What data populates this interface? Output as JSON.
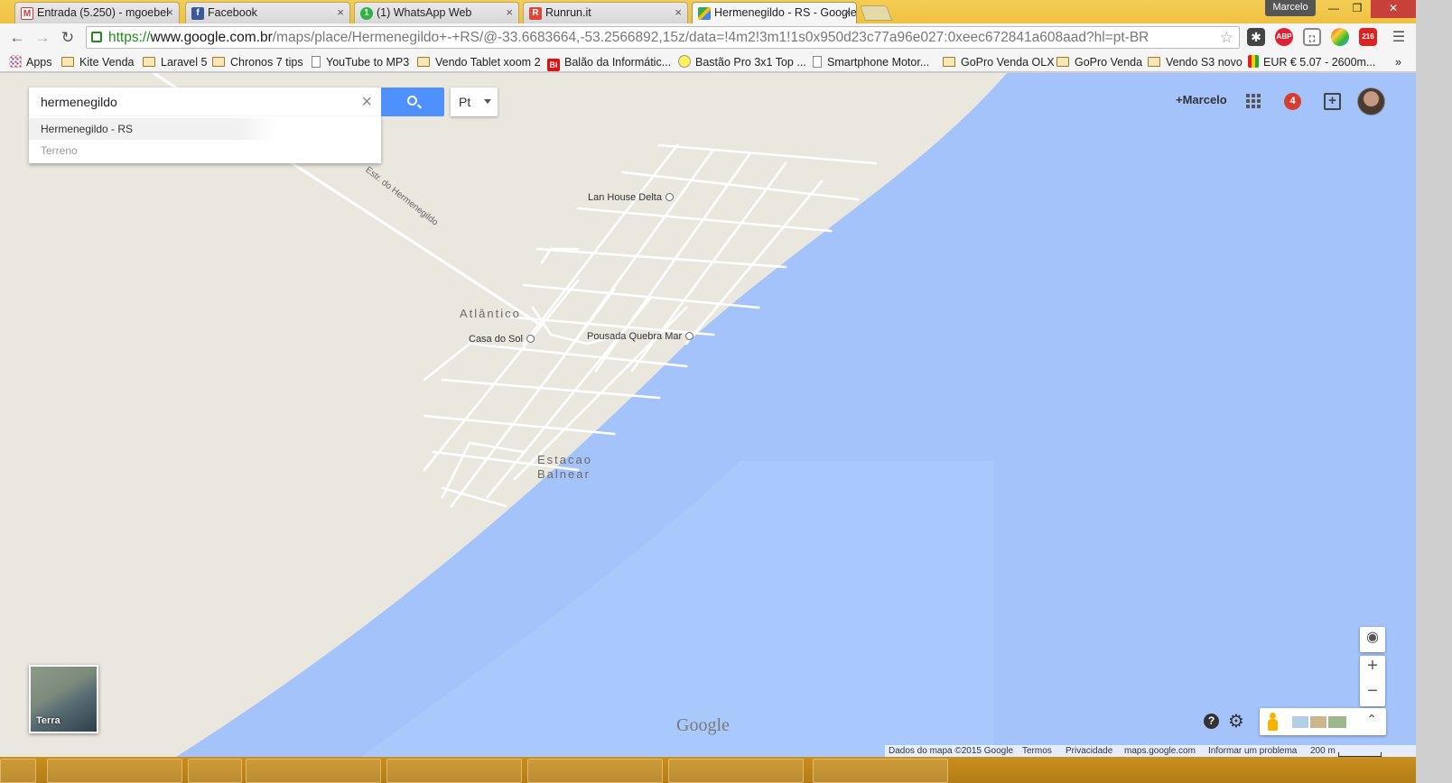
{
  "browser": {
    "tabs": [
      {
        "label": "Entrada (5.250) - mgoebel",
        "favicon": "gmail-icon",
        "active": false
      },
      {
        "label": "Facebook",
        "favicon": "facebook-icon",
        "active": false
      },
      {
        "label": "(1) WhatsApp Web",
        "favicon": "whatsapp-icon",
        "active": false
      },
      {
        "label": "Runrun.it",
        "favicon": "runrun-icon",
        "active": false
      },
      {
        "label": "Hermenegildo - RS - Google",
        "favicon": "maps-icon",
        "active": true
      }
    ],
    "profile_name": "Marcelo",
    "url": {
      "scheme": "https://",
      "host": "www.google.com.br",
      "path": "/maps/place/Hermenegildo+-+RS/@-33.6683664,-53.2566892,15z/data=!4m2!3m1!1s0x950d23c77a96e027:0xeec672841a608aad?hl=pt-BR"
    },
    "extensions": [
      {
        "name": "puzzle-icon"
      },
      {
        "name": "adblock-icon",
        "label": "ABP"
      },
      {
        "name": "screen-capture-icon"
      },
      {
        "name": "colorful-ext-icon"
      },
      {
        "name": "notify-ext-icon",
        "label": "216"
      }
    ],
    "bookmarks": [
      {
        "label": "Apps",
        "icon": "apps-icon"
      },
      {
        "label": "Kite Venda",
        "icon": "folder-icon"
      },
      {
        "label": "Laravel 5",
        "icon": "folder-icon"
      },
      {
        "label": "Chronos 7 tips",
        "icon": "folder-icon"
      },
      {
        "label": "YouTube to MP3",
        "icon": "page-icon"
      },
      {
        "label": "Vendo Tablet xoom 2",
        "icon": "folder-icon"
      },
      {
        "label": "Balão da Informátic...",
        "icon": "bi-icon"
      },
      {
        "label": "Bastão Pro 3x1 Top ...",
        "icon": "ml-icon"
      },
      {
        "label": "Smartphone Motor...",
        "icon": "page-icon"
      },
      {
        "label": "GoPro Venda OLX",
        "icon": "folder-icon"
      },
      {
        "label": "GoPro Venda",
        "icon": "folder-icon"
      },
      {
        "label": "Vendo S3 novo",
        "icon": "folder-icon"
      },
      {
        "label": "EUR € 5.07 - 2600m...",
        "icon": "chart-icon"
      }
    ],
    "bookmarks_overflow": "»"
  },
  "maps": {
    "search": {
      "value": "hermenegildo",
      "clear": "×"
    },
    "language": "Pt",
    "suggestions": [
      {
        "label": "Hermenegildo - RS"
      },
      {
        "label": "Terreno"
      }
    ],
    "user_link": "+Marcelo",
    "notification_count": "4",
    "share_glyph": "+",
    "labels": {
      "road": "Estr. do Hermenegildo",
      "lan_house": "Lan House Delta",
      "atlantico": "Atlântico",
      "casa_do_sol": "Casa do Sol",
      "pousada": "Pousada Quebra Mar",
      "estacao": "Estacao",
      "balnear": "Balnear"
    },
    "earth_label": "Terra",
    "logo": "Google",
    "zoom_in": "+",
    "zoom_out": "−",
    "help": "?",
    "expand": "⌃",
    "attribution": {
      "data": "Dados do mapa ©2015 Google",
      "terms": "Termos",
      "privacy": "Privacidade",
      "site": "maps.google.com",
      "report": "Informar um problema",
      "scale": "200 m"
    }
  },
  "colors": {
    "land": "#eae7df",
    "water": "#a3c3fa",
    "road": "#ffffff",
    "search_blue": "#4d90fe",
    "notif_red": "#d23f31",
    "window_frame": "#efc141"
  }
}
